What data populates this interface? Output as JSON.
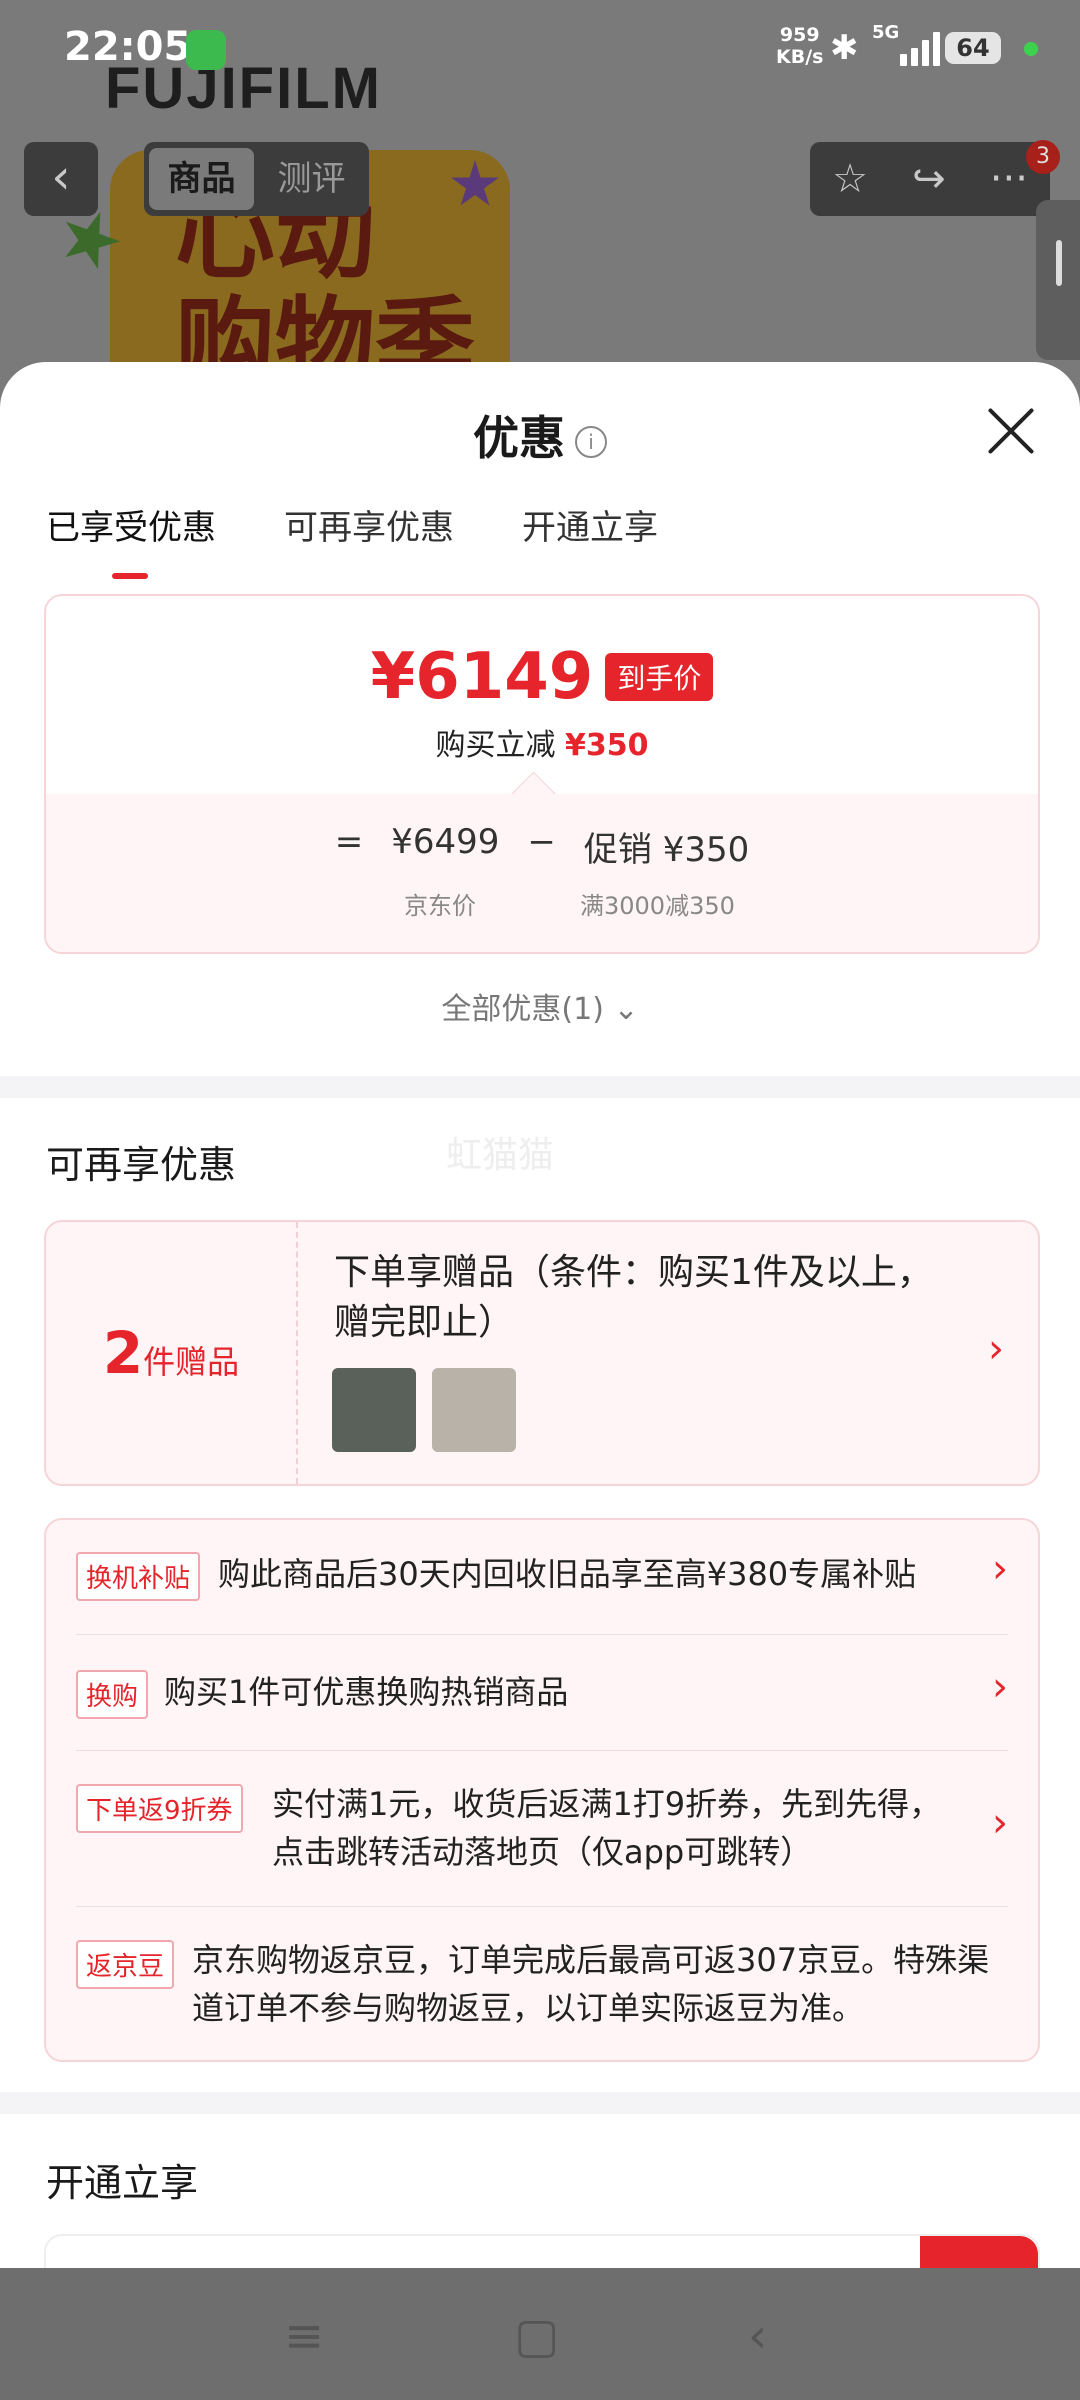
{
  "status_bar": {
    "time": "22:05",
    "net_speed": "959",
    "net_unit": "KB/s",
    "signal_label": "5G",
    "battery": "64"
  },
  "background": {
    "brand": "FUJIFILM",
    "promo_text": "心动购物季",
    "tabs": [
      "商品",
      "测评"
    ],
    "badge_count": "3"
  },
  "sheet": {
    "title": "优惠",
    "tabs": [
      "已享受优惠",
      "可再享优惠",
      "开通立享"
    ],
    "price": {
      "final": "¥6149",
      "final_tag": "到手价",
      "save_label": "购买立减",
      "save_amount": "¥350",
      "equals": "=",
      "original": "¥6499",
      "minus": "−",
      "promo_label": "促销 ¥350",
      "original_label": "京东价",
      "promo_rule": "满3000减350"
    },
    "all_promos": "全部优惠(1)"
  },
  "more_section": {
    "title": "可再享优惠",
    "watermark": "虹猫猫",
    "gift": {
      "count": "2",
      "unit": "件赠品",
      "text": "下单享赠品（条件：购买1件及以上，赠完即止）"
    },
    "promos": [
      {
        "tag": "换机补贴",
        "text": "购此商品后30天内回收旧品享至高¥380专属补贴"
      },
      {
        "tag": "换购",
        "text": "购买1件可优惠换购热销商品"
      },
      {
        "tag": "下单返9折券",
        "text": "实付满1元，收货后返满1打9折券，先到先得，点击跳转活动落地页（仅app可跳转）"
      },
      {
        "tag": "返京豆",
        "text": "京东购物返京豆，订单完成后最高可返307京豆。特殊渠道订单不参与购物返豆，以订单实际返豆为准。"
      }
    ]
  },
  "open_section": {
    "title": "开通立享"
  },
  "colors": {
    "accent": "#e5242b",
    "pink_bg": "#fff5f6"
  }
}
